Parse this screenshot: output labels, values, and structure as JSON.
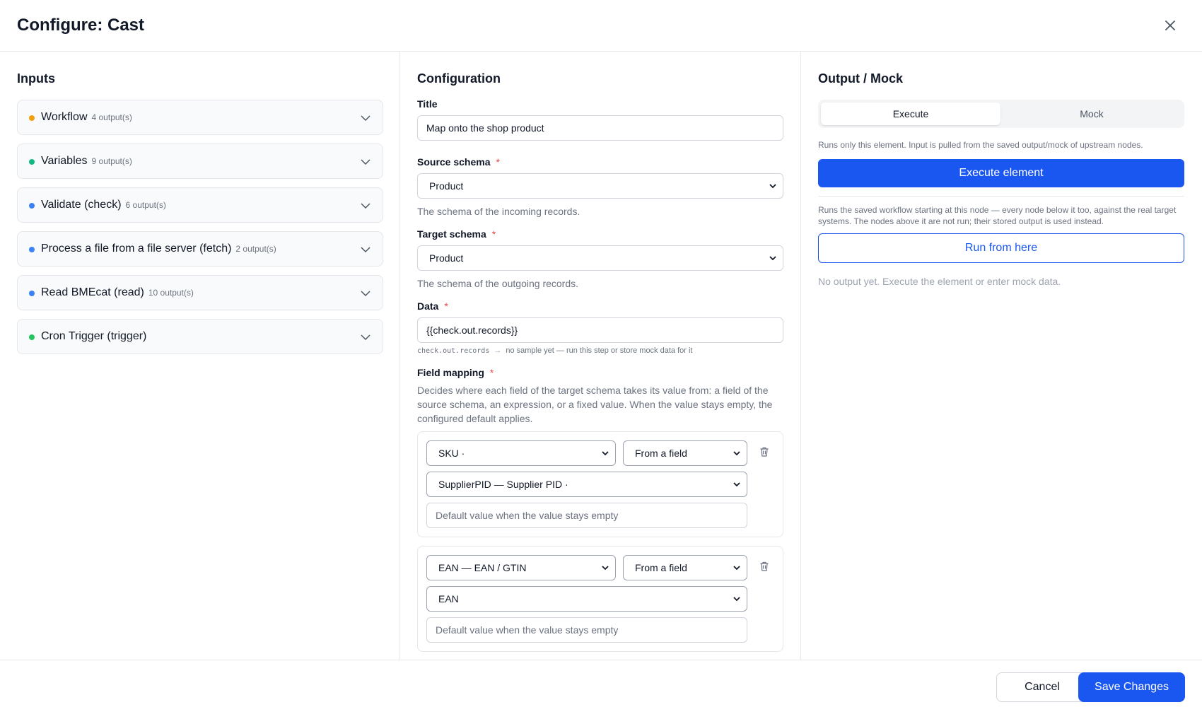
{
  "dialog": {
    "title": "Configure: Cast"
  },
  "inputs": {
    "heading": "Inputs",
    "items": [
      {
        "name": "Workflow",
        "count": "4 output(s)",
        "dot_color": "#f59e0b"
      },
      {
        "name": "Variables",
        "count": "9 output(s)",
        "dot_color": "#10b981"
      },
      {
        "name": "Validate (check)",
        "count": "6 output(s)",
        "dot_color": "#3b82f6"
      },
      {
        "name": "Process a file from a file server (fetch)",
        "count": "2 output(s)",
        "dot_color": "#3b82f6"
      },
      {
        "name": "Read BMEcat (read)",
        "count": "10 output(s)",
        "dot_color": "#3b82f6"
      },
      {
        "name": "Cron Trigger (trigger)",
        "count": "",
        "dot_color": "#22c55e"
      }
    ]
  },
  "config": {
    "heading": "Configuration",
    "title_label": "Title",
    "title_value": "Map onto the shop product",
    "source_label": "Source schema",
    "source_value": "Product",
    "source_help": "The schema of the incoming records.",
    "target_label": "Target schema",
    "target_value": "Product",
    "target_help": "The schema of the outgoing records.",
    "data_label": "Data",
    "data_value": "{{check.out.records}}",
    "data_hint_path": "check.out.records",
    "data_hint_arrow": "→",
    "data_hint_text": "no sample yet — run this step or store mock data for it",
    "mapping_label": "Field mapping",
    "mapping_desc": "Decides where each field of the target schema takes its value from: a field of the source schema, an expression, or a fixed value. When the value stays empty, the configured default applies.",
    "required_mark": "*",
    "mappings": [
      {
        "target": "SKU ·",
        "mode": "From a field",
        "source": "SupplierPID — Supplier PID ·",
        "default_placeholder": "Default value when the value stays empty"
      },
      {
        "target": "EAN — EAN / GTIN",
        "mode": "From a field",
        "source": "EAN",
        "default_placeholder": "Default value when the value stays empty"
      }
    ]
  },
  "output": {
    "heading": "Output / Mock",
    "tab_execute": "Execute",
    "tab_mock": "Mock",
    "execute_note": "Runs only this element. Input is pulled from the saved output/mock of upstream nodes.",
    "execute_button": "Execute element",
    "run_note": "Runs the saved workflow starting at this node — every node below it too, against the real target systems. The nodes above it are not run; their stored output is used instead.",
    "run_button": "Run from here",
    "empty_text": "No output yet. Execute the element or enter mock data."
  },
  "footer": {
    "cancel": "Cancel",
    "save": "Save Changes"
  },
  "colors": {
    "accent": "#1a56f0",
    "required": "#ef4444"
  }
}
